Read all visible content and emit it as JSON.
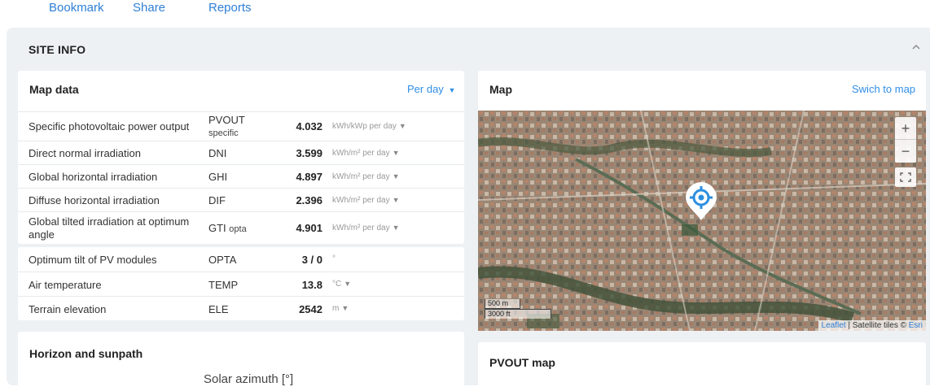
{
  "nav": {
    "links": [
      "Bookmark",
      "Share",
      "Reports"
    ]
  },
  "site_info": {
    "title": "SITE INFO",
    "collapse_icon": "chevron-up-icon"
  },
  "map_data": {
    "title": "Map data",
    "period_label": "Per day",
    "rows": [
      {
        "name": "Specific photovoltaic power output",
        "abbr": "PVOUT",
        "abbr_sub": "specific",
        "value": "4.032",
        "unit": "kWh/kWp per day"
      },
      {
        "name": "Direct normal irradiation",
        "abbr": "DNI",
        "abbr_sub": "",
        "value": "3.599",
        "unit": "kWh/m² per day"
      },
      {
        "name": "Global horizontal irradiation",
        "abbr": "GHI",
        "abbr_sub": "",
        "value": "4.897",
        "unit": "kWh/m² per day"
      },
      {
        "name": "Diffuse horizontal irradiation",
        "abbr": "DIF",
        "abbr_sub": "",
        "value": "2.396",
        "unit": "kWh/m² per day"
      },
      {
        "name": "Global tilted irradiation at optimum angle",
        "abbr": "GTI",
        "abbr_sub": "opta",
        "value": "4.901",
        "unit": "kWh/m² per day"
      }
    ],
    "rows2": [
      {
        "name": "Optimum tilt of PV modules",
        "abbr": "OPTA",
        "value": "3 / 0",
        "unit": "°"
      },
      {
        "name": "Air temperature",
        "abbr": "TEMP",
        "value": "13.8",
        "unit": "°C"
      },
      {
        "name": "Terrain elevation",
        "abbr": "ELE",
        "value": "2542",
        "unit": "m"
      }
    ]
  },
  "map": {
    "title": "Map",
    "switch_label": "Swich to map",
    "zoom_in": "+",
    "zoom_out": "−",
    "scale_metric": "500 m",
    "scale_imperial": "3000 ft",
    "attribution_leaflet": "Leaflet",
    "attribution_sep": " | Satellite tiles © ",
    "attribution_esri": "Esri"
  },
  "horizon": {
    "title": "Horizon and sunpath",
    "azimuth_label": "Solar azimuth [°]"
  },
  "pvout_map": {
    "title": "PVOUT map"
  }
}
